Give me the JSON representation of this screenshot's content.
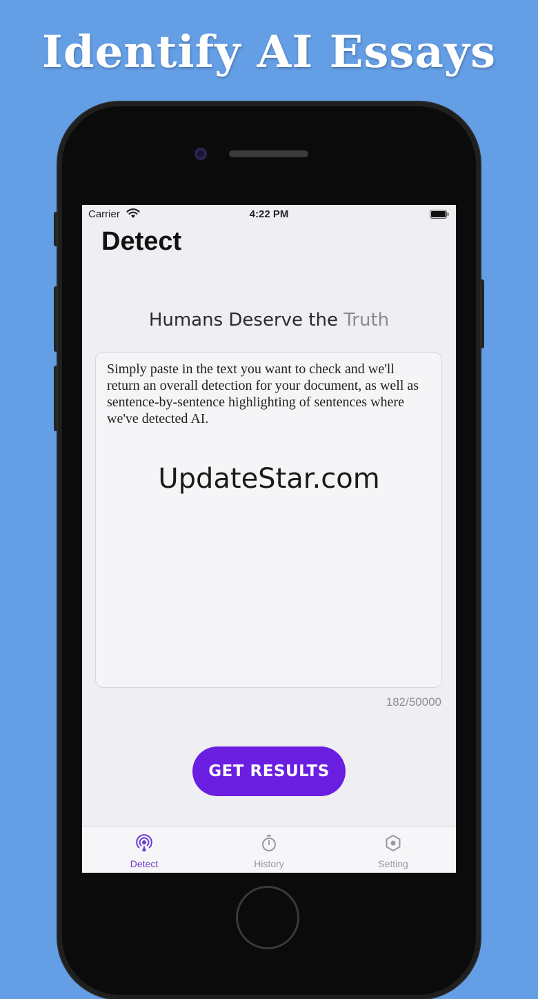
{
  "banner": {
    "title": "Identify AI Essays"
  },
  "status_bar": {
    "carrier": "Carrier",
    "time": "4:22 PM"
  },
  "nav": {
    "title": "Detect"
  },
  "tagline": {
    "main": "Humans Deserve the ",
    "accent": "Truth"
  },
  "input": {
    "placeholder": "Simply paste in the text you want to check and we'll return an overall detection for your document, as well as sentence-by-sentence highlighting of sentences where we've detected AI.",
    "char_count": "182/50000"
  },
  "watermark": "UpdateStar.com",
  "actions": {
    "get_results_label": "GET RESULTS"
  },
  "tabs": [
    {
      "label": "Detect",
      "icon": "radar-icon",
      "active": true
    },
    {
      "label": "History",
      "icon": "stopwatch-icon",
      "active": false
    },
    {
      "label": "Setting",
      "icon": "hexagon-gear-icon",
      "active": false
    }
  ],
  "colors": {
    "background": "#649ee5",
    "accent": "#6a1ee0",
    "active_tab": "#6a3bd6",
    "inactive_tab": "#9a9a9e"
  }
}
